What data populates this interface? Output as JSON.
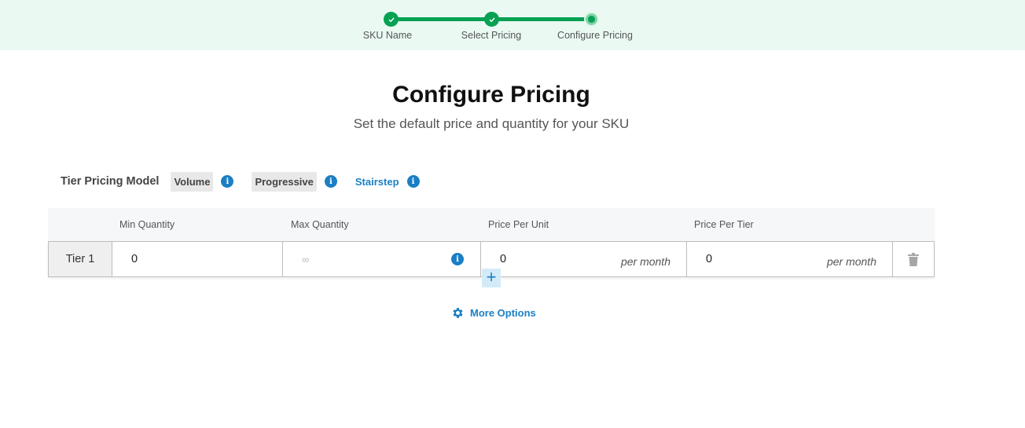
{
  "stepper": {
    "steps": [
      {
        "label": "SKU Name",
        "status": "complete"
      },
      {
        "label": "Select Pricing",
        "status": "complete"
      },
      {
        "label": "Configure Pricing",
        "status": "current"
      }
    ]
  },
  "header": {
    "title": "Configure Pricing",
    "subtitle": "Set the default price and quantity for your SKU"
  },
  "pricing_model": {
    "label": "Tier Pricing Model",
    "options": [
      {
        "label": "Volume",
        "info_icon": "info-icon"
      },
      {
        "label": "Progressive",
        "info_icon": "info-icon"
      },
      {
        "label": "Stairstep",
        "info_icon": "info-icon"
      }
    ]
  },
  "table": {
    "columns": [
      "Min Quantity",
      "Max Quantity",
      "Price Per Unit",
      "Price Per Tier"
    ],
    "rows": [
      {
        "tier": "Tier 1",
        "min_quantity": "0",
        "max_quantity_placeholder": "∞",
        "price_per_unit": "0",
        "price_per_unit_suffix": "per month",
        "price_per_tier": "0",
        "price_per_tier_suffix": "per month"
      }
    ],
    "add_tier_label": "+",
    "info_glyph": "i"
  },
  "more_options": {
    "label": "More Options",
    "icon": "gear-icon"
  },
  "colors": {
    "accent_blue": "#1a7fc4",
    "step_green": "#06a152",
    "stepper_bg": "#eafaf3"
  }
}
